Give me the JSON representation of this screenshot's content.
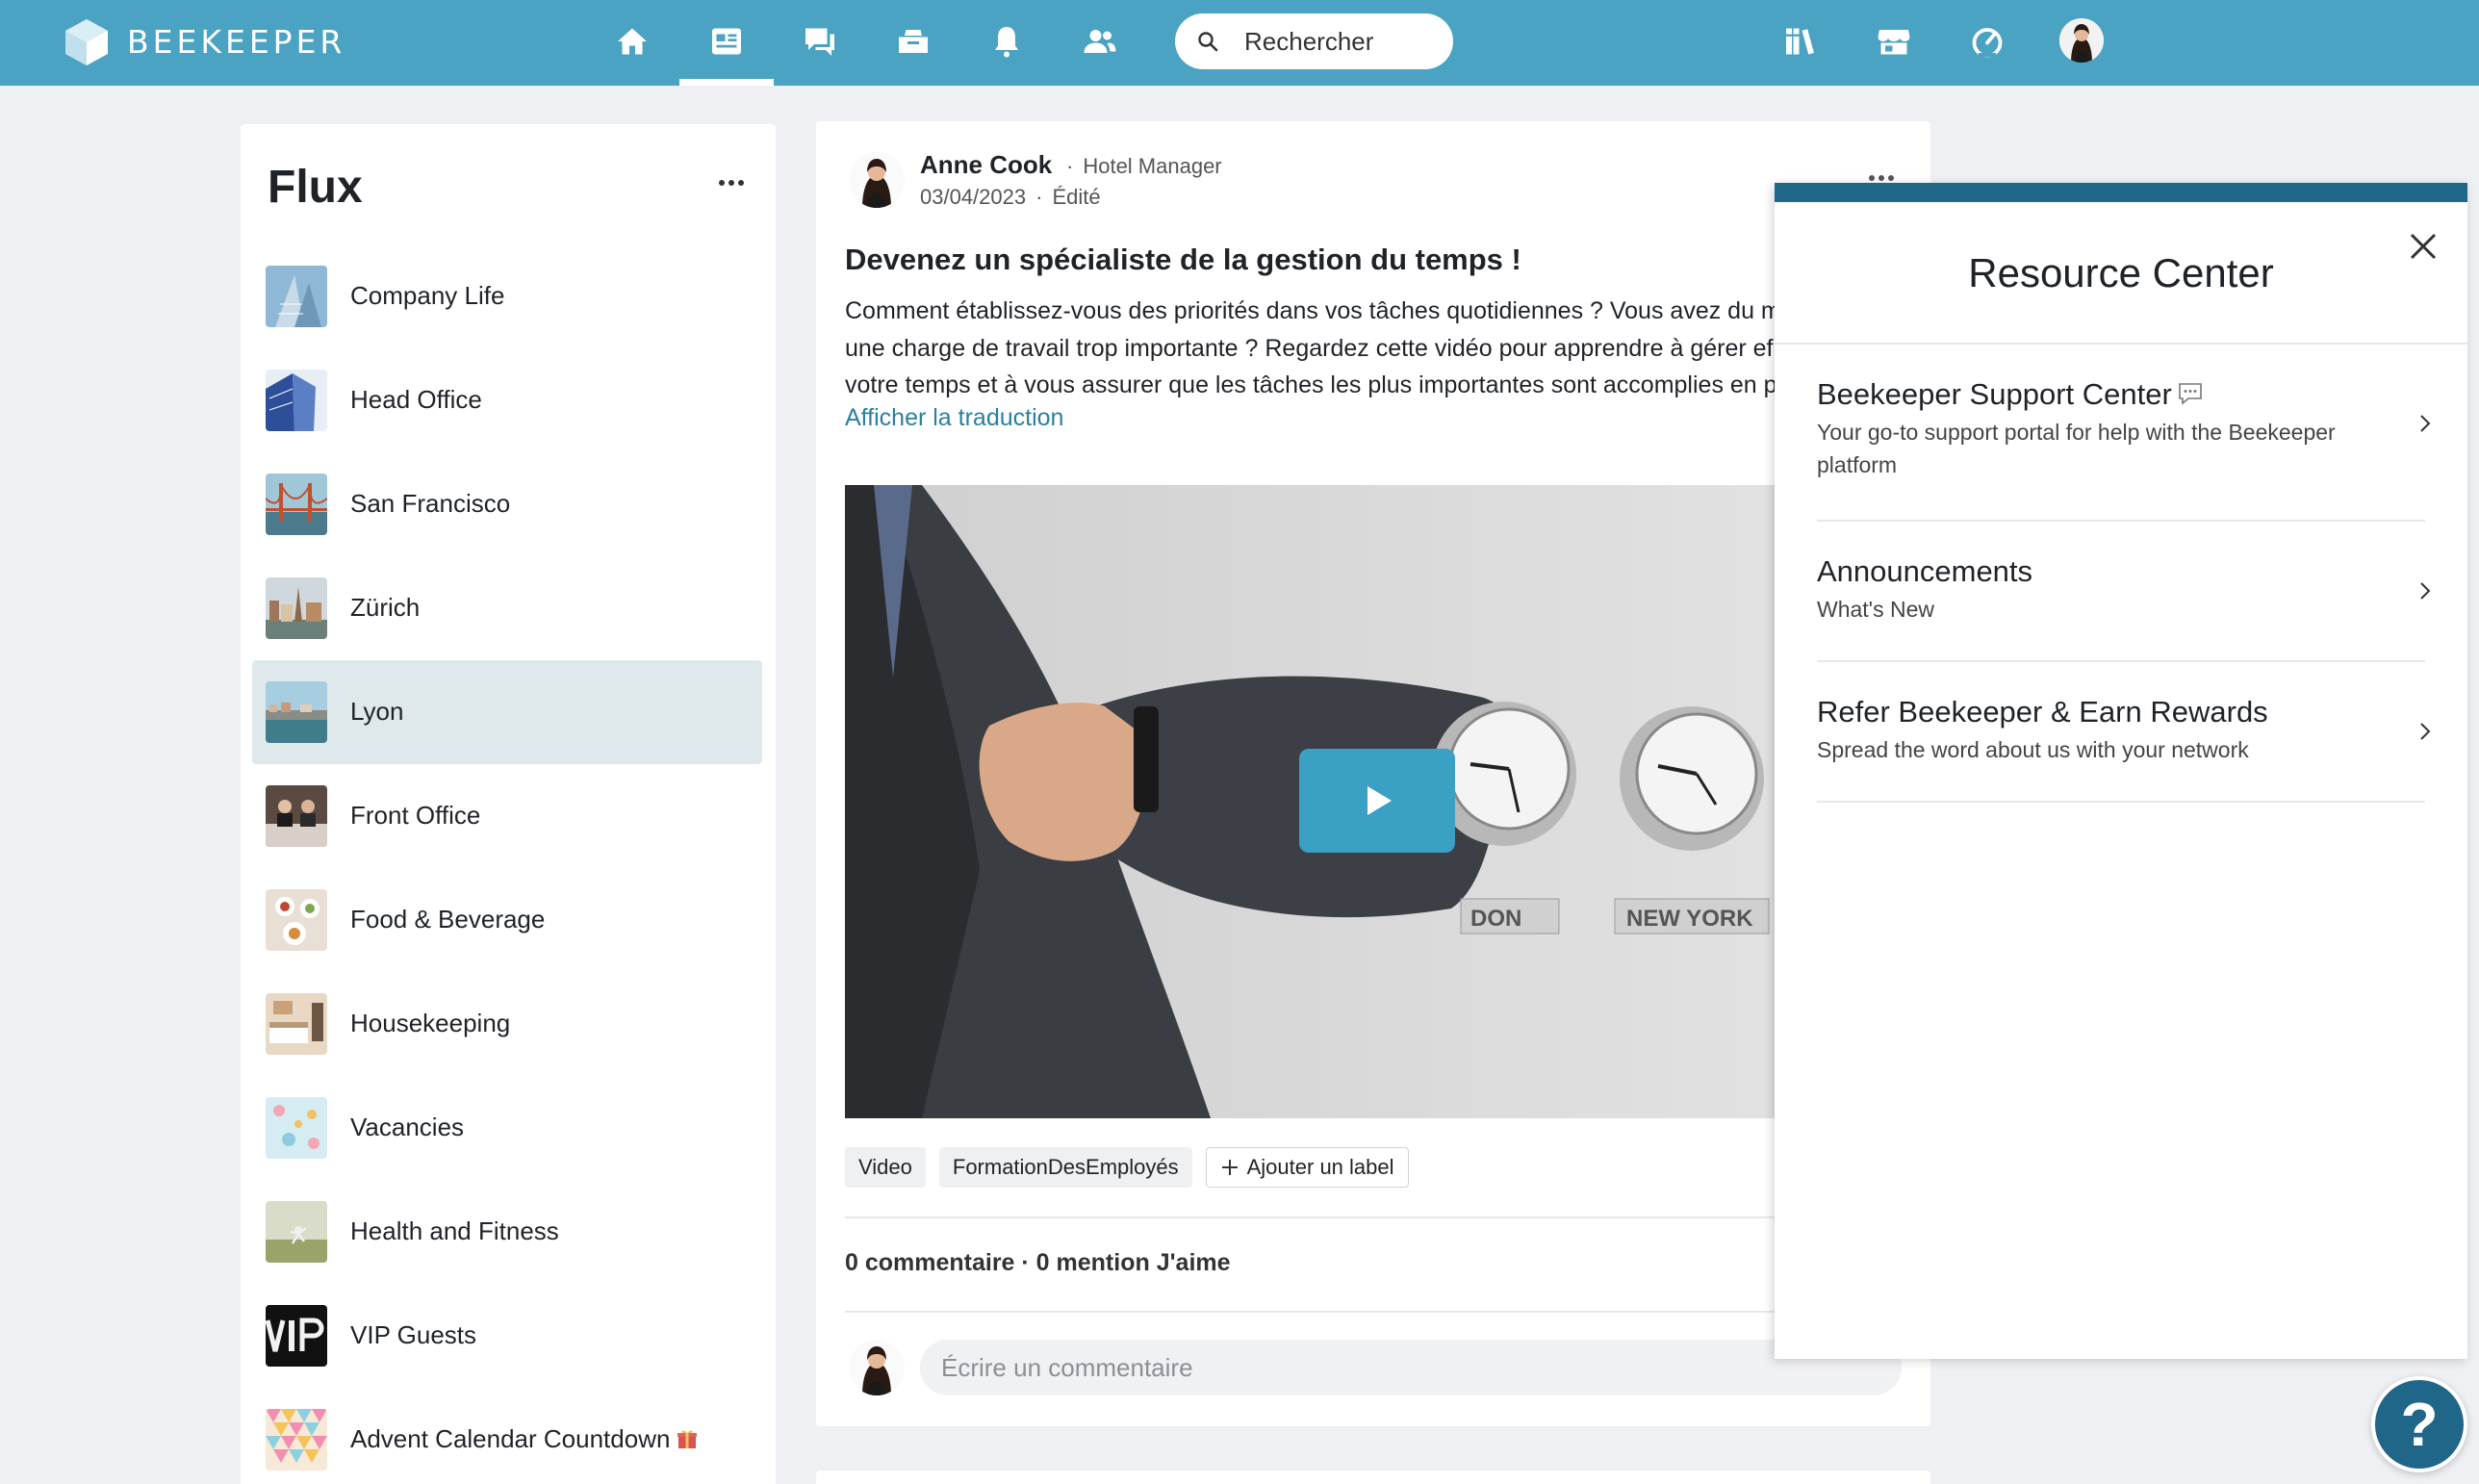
{
  "header": {
    "brand": "BEEKEEPER",
    "search_placeholder": "Rechercher",
    "nav_icons": [
      "home-icon",
      "news-feed-icon",
      "chat-icon",
      "inbox-icon",
      "notifications-icon",
      "people-icon"
    ],
    "right_icons": [
      "library-icon",
      "store-icon",
      "dashboard-icon",
      "profile-avatar"
    ],
    "accent_color": "#4aa3c2"
  },
  "sidebar": {
    "title": "Flux",
    "items": [
      {
        "label": "Company Life"
      },
      {
        "label": "Head Office"
      },
      {
        "label": "San Francisco"
      },
      {
        "label": "Zürich"
      },
      {
        "label": "Lyon",
        "active": true
      },
      {
        "label": "Front Office"
      },
      {
        "label": "Food & Beverage"
      },
      {
        "label": "Housekeeping"
      },
      {
        "label": "Vacancies"
      },
      {
        "label": "Health and Fitness"
      },
      {
        "label": "VIP Guests"
      },
      {
        "label": "Advent Calendar Countdown"
      }
    ]
  },
  "post": {
    "author": "Anne Cook",
    "role": "Hotel Manager",
    "date": "03/04/2023",
    "edited": "Édité",
    "title": "Devenez un spécialiste de la gestion du temps !",
    "body_lines": [
      "Comment établissez-vous des priorités dans vos tâches quotidiennes ? Vous avez du m",
      "une charge de travail trop importante ? Regardez cette vidéo pour apprendre à gérer ef",
      "votre temps et à vous assurer que les tâches les plus importantes sont accomplies en p"
    ],
    "translate_link": "Afficher la traduction",
    "video_labels": [
      "DON",
      "NEW YORK"
    ],
    "tags": [
      "Video",
      "FormationDesEmployés"
    ],
    "add_label": "Ajouter un label",
    "stats": "0 commentaire · 0 mention J'aime",
    "comment_placeholder": "Écrire un commentaire"
  },
  "resource_center": {
    "title": "Resource Center",
    "items": [
      {
        "title": "Beekeeper Support Center",
        "desc": "Your go-to support portal for help with the Beekeeper platform"
      },
      {
        "title": "Announcements",
        "desc": "What's New"
      },
      {
        "title": "Refer Beekeeper & Earn Rewards",
        "desc": "Spread the word about us with your network"
      }
    ]
  },
  "help": {
    "label": "?"
  }
}
